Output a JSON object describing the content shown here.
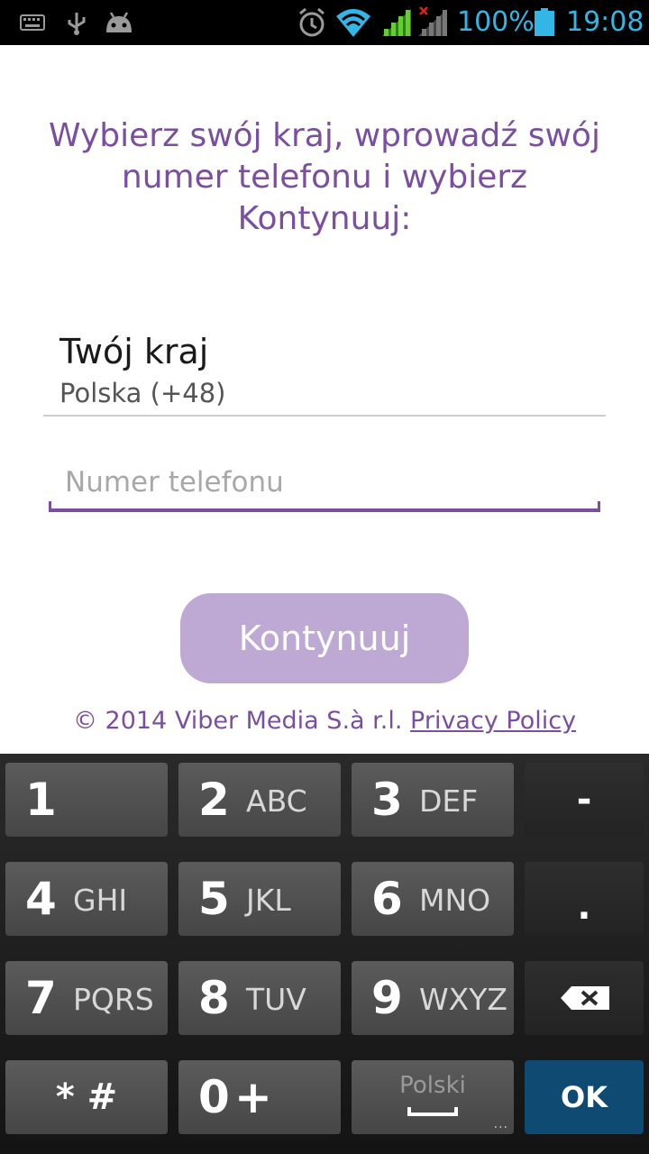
{
  "status_bar": {
    "battery": "100%",
    "time": "19:08",
    "icons": [
      "keyboard-icon",
      "usb-icon",
      "android-debug-icon",
      "alarm-icon",
      "wifi-icon",
      "signal-icon",
      "signal-no-data-icon",
      "battery-icon"
    ]
  },
  "main": {
    "intro_text": "Wybierz swój kraj, wprowadź swój numer telefonu i wybierz Kontynuuj:",
    "country_title": "Twój kraj",
    "country_value": "Polska (+48)",
    "phone_placeholder": "Numer telefonu",
    "phone_value": "",
    "continue_label": "Kontynuuj",
    "footer_copyright": "© 2014 Viber Media S.à r.l.",
    "footer_link": "Privacy Policy"
  },
  "colors": {
    "accent": "#7b4fa0",
    "button_disabled": "#bda9d3",
    "status_blue": "#33b5e5",
    "ok_key": "#0e4a72"
  },
  "keyboard": {
    "k1": {
      "num": "1",
      "letters": ""
    },
    "k2": {
      "num": "2",
      "letters": "ABC"
    },
    "k3": {
      "num": "3",
      "letters": "DEF"
    },
    "k_dash": "-",
    "k4": {
      "num": "4",
      "letters": "GHI"
    },
    "k5": {
      "num": "5",
      "letters": "JKL"
    },
    "k6": {
      "num": "6",
      "letters": "MNO"
    },
    "k_dot": ".",
    "k7": {
      "num": "7",
      "letters": "PQRS"
    },
    "k8": {
      "num": "8",
      "letters": "TUV"
    },
    "k9": {
      "num": "9",
      "letters": "WXYZ"
    },
    "k_star": "* #",
    "k0": {
      "num": "0",
      "letters": "+"
    },
    "k_lang": "Polski",
    "k_ok": "OK"
  }
}
